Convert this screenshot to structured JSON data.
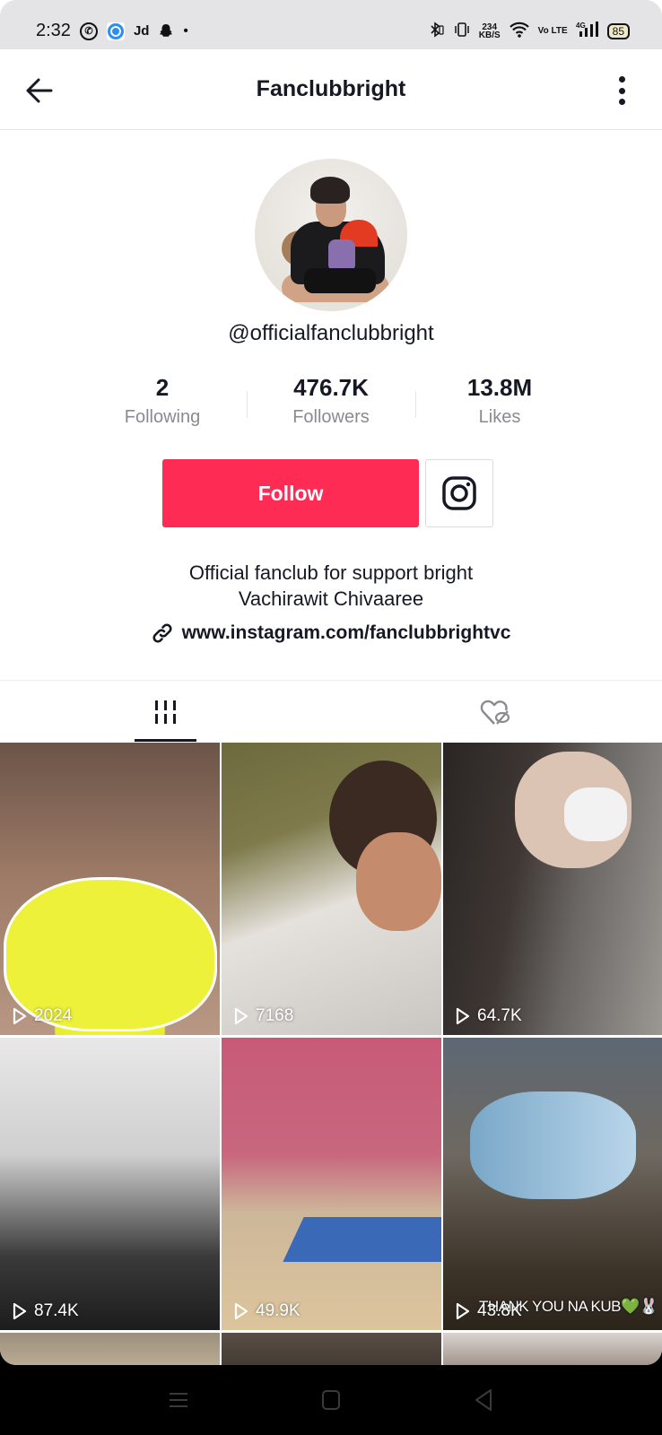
{
  "status_bar": {
    "time": "2:32",
    "left_icons": [
      "whatsapp-icon",
      "blue-app-icon",
      "Jd",
      "snapchat-icon",
      "dot"
    ],
    "speed_value": "234",
    "speed_unit": "KB/S",
    "volte": "Vo LTE",
    "network": "4G",
    "battery": "85"
  },
  "header": {
    "title": "Fanclubbright",
    "back_icon": "arrow-left",
    "more_icon": "vertical-dots"
  },
  "profile": {
    "username": "@officialfanclubbright",
    "stats": [
      {
        "value": "2",
        "label": "Following"
      },
      {
        "value": "476.7K",
        "label": "Followers"
      },
      {
        "value": "13.8M",
        "label": "Likes"
      }
    ],
    "follow_label": "Follow",
    "follow_color": "#fe2c55",
    "bio_line1": "Official fanclub for support bright",
    "bio_line2": "Vachirawit Chivaaree",
    "link": "www.instagram.com/fanclubbrightvc"
  },
  "tabs": [
    {
      "name": "videos",
      "icon": "grid-lines",
      "active": true
    },
    {
      "name": "liked",
      "icon": "heart-hidden",
      "active": false
    }
  ],
  "videos": [
    {
      "views": "2024"
    },
    {
      "views": "7168"
    },
    {
      "views": "64.7K"
    },
    {
      "views": "87.4K"
    },
    {
      "views": "49.9K"
    },
    {
      "views": "43.8K",
      "caption": "THANK YOU NA KUB💚🐰"
    },
    {
      "views": ""
    },
    {
      "views": ""
    },
    {
      "views": ""
    }
  ]
}
